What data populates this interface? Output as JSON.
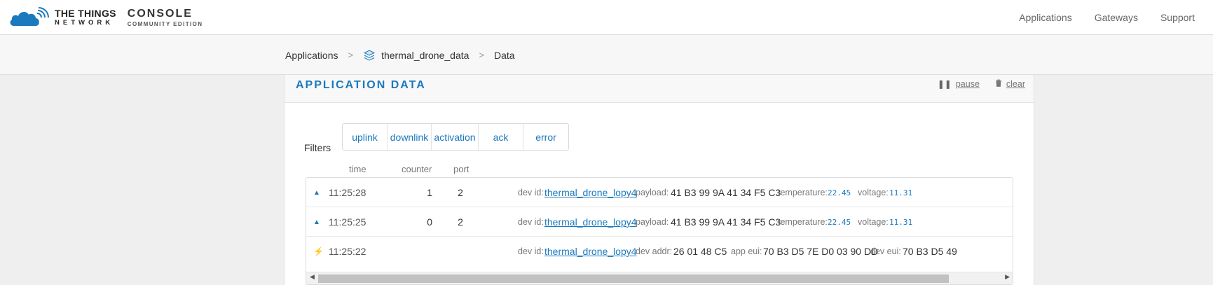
{
  "brand": {
    "line1": "THE THINGS",
    "line2": "NETWORK",
    "console": "CONSOLE",
    "edition": "COMMUNITY EDITION"
  },
  "nav": {
    "applications": "Applications",
    "gateways": "Gateways",
    "support": "Support"
  },
  "breadcrumb": {
    "applications": "Applications",
    "app": "thermal_drone_data",
    "current": "Data",
    "sep": ">"
  },
  "panel": {
    "title": "APPLICATION DATA",
    "pause": "pause",
    "clear": "clear"
  },
  "filters": {
    "label": "Filters",
    "items": [
      "uplink",
      "downlink",
      "activation",
      "ack",
      "error"
    ]
  },
  "columns": {
    "time": "time",
    "counter": "counter",
    "port": "port"
  },
  "rows": [
    {
      "type": "uplink",
      "time": "11:25:28",
      "counter": "1",
      "port": "2",
      "dev_id_label": "dev id:",
      "dev_id": "thermal_drone_lopy4",
      "payload_label": "payload:",
      "payload": "41 B3 99 9A 41 34 F5 C3",
      "temperature_label": "temperature:",
      "temperature": "22.45",
      "voltage_label": "voltage:",
      "voltage": "11.31"
    },
    {
      "type": "uplink",
      "time": "11:25:25",
      "counter": "0",
      "port": "2",
      "dev_id_label": "dev id:",
      "dev_id": "thermal_drone_lopy4",
      "payload_label": "payload:",
      "payload": "41 B3 99 9A 41 34 F5 C3",
      "temperature_label": "temperature:",
      "temperature": "22.45",
      "voltage_label": "voltage:",
      "voltage": "11.31"
    },
    {
      "type": "activation",
      "time": "11:25:22",
      "dev_id_label": "dev id:",
      "dev_id": "thermal_drone_lopy4",
      "dev_addr_label": "dev addr:",
      "dev_addr": "26 01 48 C5",
      "app_eui_label": "app eui:",
      "app_eui": "70 B3 D5 7E D0 03 90 DD",
      "dev_eui_label": "dev eui:",
      "dev_eui": "70 B3 D5 49"
    }
  ],
  "colors": {
    "accent": "#1b79bd",
    "activation": "#f2b33d"
  }
}
